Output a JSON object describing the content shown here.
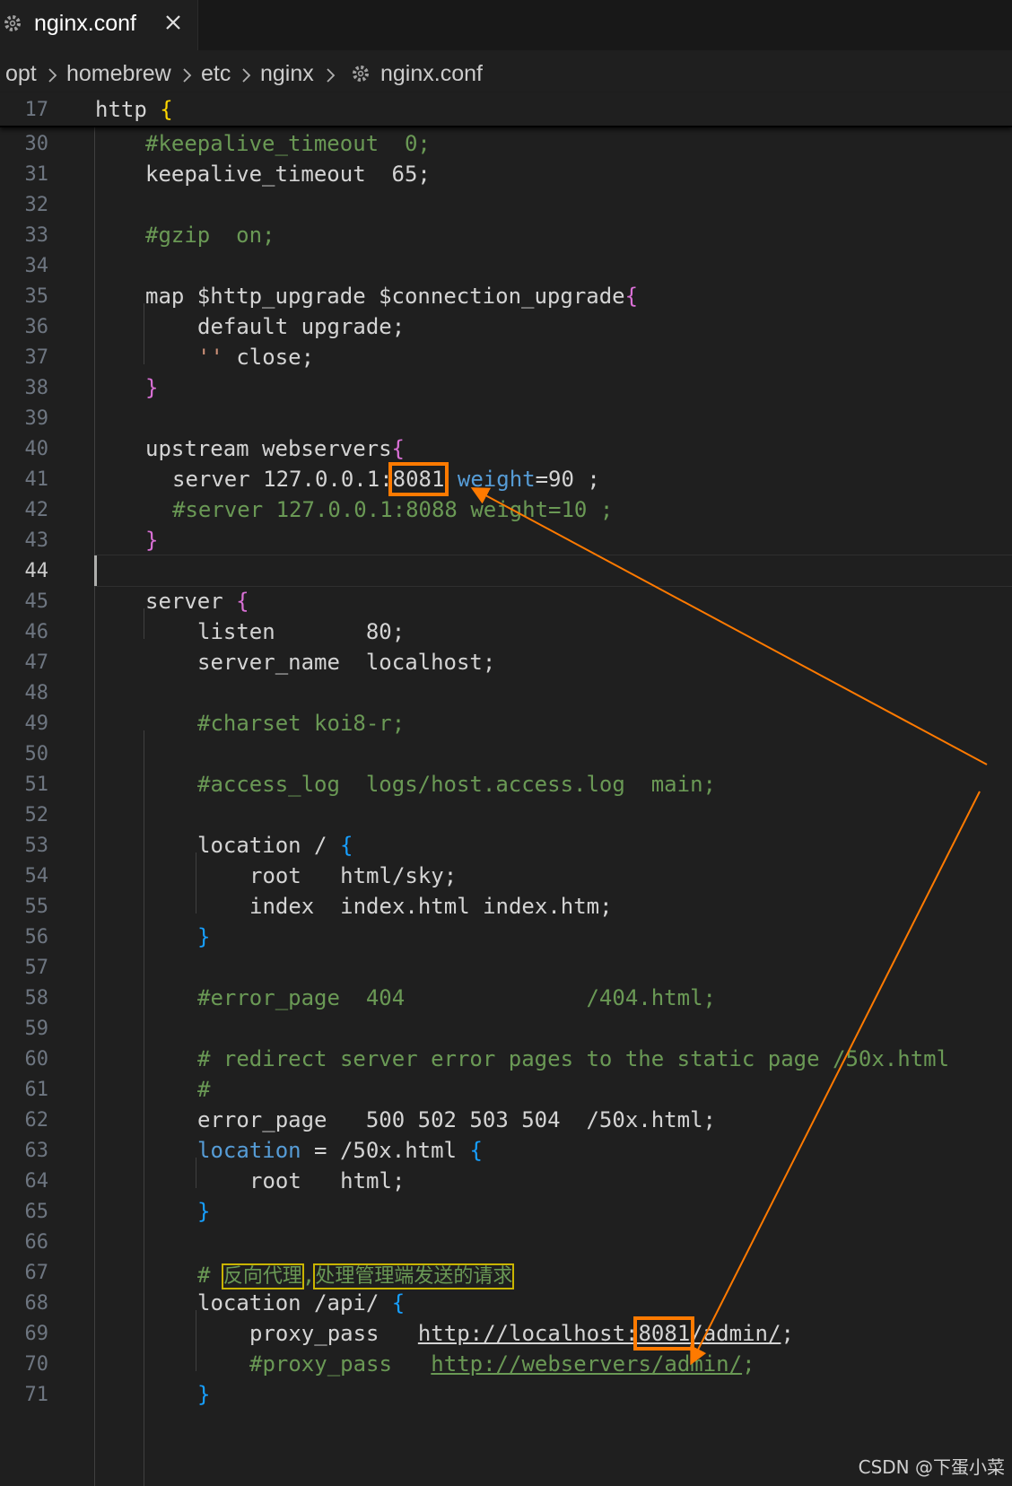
{
  "tab": {
    "title": "nginx.conf",
    "icon": "gear-icon",
    "close_icon": "close-icon"
  },
  "breadcrumb": [
    "opt",
    "homebrew",
    "etc",
    "nginx",
    "nginx.conf"
  ],
  "sticky": {
    "line_number": "17",
    "text": "http",
    "brace": "{"
  },
  "lines": [
    {
      "n": "30",
      "t": "#keepalive_timeout  0;"
    },
    {
      "n": "31",
      "t": "keepalive_timeout  65;"
    },
    {
      "n": "32",
      "t": ""
    },
    {
      "n": "33",
      "t": "#gzip  on;"
    },
    {
      "n": "34",
      "t": ""
    },
    {
      "n": "35",
      "t": "map $http_upgrade $connection_upgrade{"
    },
    {
      "n": "36",
      "t": "default upgrade;"
    },
    {
      "n": "37",
      "t": "'' close;"
    },
    {
      "n": "38",
      "t": "}"
    },
    {
      "n": "39",
      "t": ""
    },
    {
      "n": "40",
      "t": "upstream webservers{"
    },
    {
      "n": "41",
      "t": "server 127.0.0.1:8081 weight=90 ;"
    },
    {
      "n": "42",
      "t": "#server 127.0.0.1:8088 weight=10 ;"
    },
    {
      "n": "43",
      "t": "}"
    },
    {
      "n": "44",
      "t": ""
    },
    {
      "n": "45",
      "t": "server {"
    },
    {
      "n": "46",
      "t": "listen       80;"
    },
    {
      "n": "47",
      "t": "server_name  localhost;"
    },
    {
      "n": "48",
      "t": ""
    },
    {
      "n": "49",
      "t": "#charset koi8-r;"
    },
    {
      "n": "50",
      "t": ""
    },
    {
      "n": "51",
      "t": "#access_log  logs/host.access.log  main;"
    },
    {
      "n": "52",
      "t": ""
    },
    {
      "n": "53",
      "t": "location / {"
    },
    {
      "n": "54",
      "t": "root   html/sky;"
    },
    {
      "n": "55",
      "t": "index  index.html index.htm;"
    },
    {
      "n": "56",
      "t": "}"
    },
    {
      "n": "57",
      "t": ""
    },
    {
      "n": "58",
      "t": "#error_page  404              /404.html;"
    },
    {
      "n": "59",
      "t": ""
    },
    {
      "n": "60",
      "t": "# redirect server error pages to the static page /50x.html"
    },
    {
      "n": "61",
      "t": "#"
    },
    {
      "n": "62",
      "t": "error_page   500 502 503 504  /50x.html;"
    },
    {
      "n": "63",
      "t": "location = /50x.html {"
    },
    {
      "n": "64",
      "t": "root   html;"
    },
    {
      "n": "65",
      "t": "}"
    },
    {
      "n": "66",
      "t": ""
    },
    {
      "n": "67",
      "t": "# 反向代理,处理管理端发送的请求"
    },
    {
      "n": "68",
      "t": "location /api/ {"
    },
    {
      "n": "69",
      "t": "proxy_pass   http://localhost:8081/admin/;"
    },
    {
      "n": "70",
      "t": "#proxy_pass   http://webservers/admin/;"
    },
    {
      "n": "71",
      "t": "}"
    }
  ],
  "active_line": "44",
  "watermark": "CSDN @下蛋小菜",
  "colors": {
    "comment": "#6a9955",
    "keyword": "#569cd6",
    "bracket_gold": "#ffd700",
    "bracket_pink": "#da70d6",
    "bracket_blue": "#179fff",
    "annotation": "#ff7a00",
    "editor_bg": "#1f1f1f"
  }
}
